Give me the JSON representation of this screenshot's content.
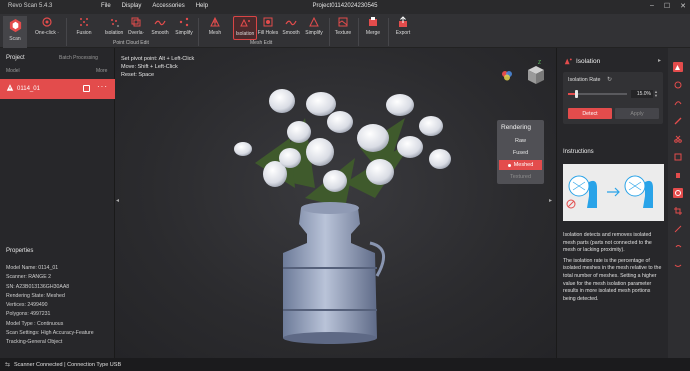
{
  "titlebar": {
    "app_name": "Revo Scan 5.4.3",
    "menu": [
      "File",
      "Display",
      "Accessories",
      "Help"
    ],
    "project_title": "Project011420242305​45"
  },
  "toolbar": {
    "scan": "Scan",
    "one_click": "One-click ·",
    "point_cloud_tools": [
      "Fusion",
      "Isolation",
      "Overla·",
      "Smooth",
      "Simplify"
    ],
    "point_cloud_group": "Point Cloud Edit",
    "mesh_tools": [
      "Mesh",
      "Isolation",
      "Fill Holes",
      "Smooth",
      "Simplify"
    ],
    "mesh_group": "Mesh Edit",
    "texture": "Texture",
    "merge": "Merge",
    "export": "Export"
  },
  "left_panel": {
    "title": "Project",
    "batch": "Batch Processing",
    "model_header": "Model",
    "more_header": "More",
    "model_name": "0114_01",
    "model_dots": "···",
    "properties_title": "Properties",
    "properties": [
      "Model Name:  0114_01",
      "Scanner:  RANGE 2",
      "SN:  A23B013136GH30AA8",
      "Rendering State:  Meshed",
      "Vertices:  2499490",
      "Polygons:  4997231",
      "Model Type :  Continuous",
      "Scan Settings:  High Accuracy-Feature",
      "Tracking-General Object"
    ]
  },
  "viewport": {
    "hints": [
      "Set pivot point: Alt + Left-Click",
      "Move: Shift + Left-Click",
      "Reset: Space"
    ]
  },
  "rendering": {
    "title": "Rendering",
    "options": [
      "Raw",
      "Fused",
      "Meshed",
      "Textured"
    ],
    "selected": "Meshed"
  },
  "isolation": {
    "title": "Isolation",
    "rate_label": "Isolation Rate",
    "rate_value": "15.0%",
    "rate_fraction": 0.15,
    "detect": "Detect",
    "apply": "Apply"
  },
  "instructions": {
    "title": "Instructions",
    "p1": "Isolation detects and removes isolated mesh parts (parts not connected to the mesh or lacking proximity).",
    "p2": "The isolation rate is the percentage of isolated meshes in the mesh relative to the total number of meshes. Setting a higher value for the mesh isolation parameter results in more isolated mesh portions being detected."
  },
  "statusbar": {
    "status": "Scanner Connected | Connection Type USB"
  },
  "colors": {
    "accent": "#e34c4c",
    "panel": "#27272a",
    "toolbar": "#323235"
  }
}
